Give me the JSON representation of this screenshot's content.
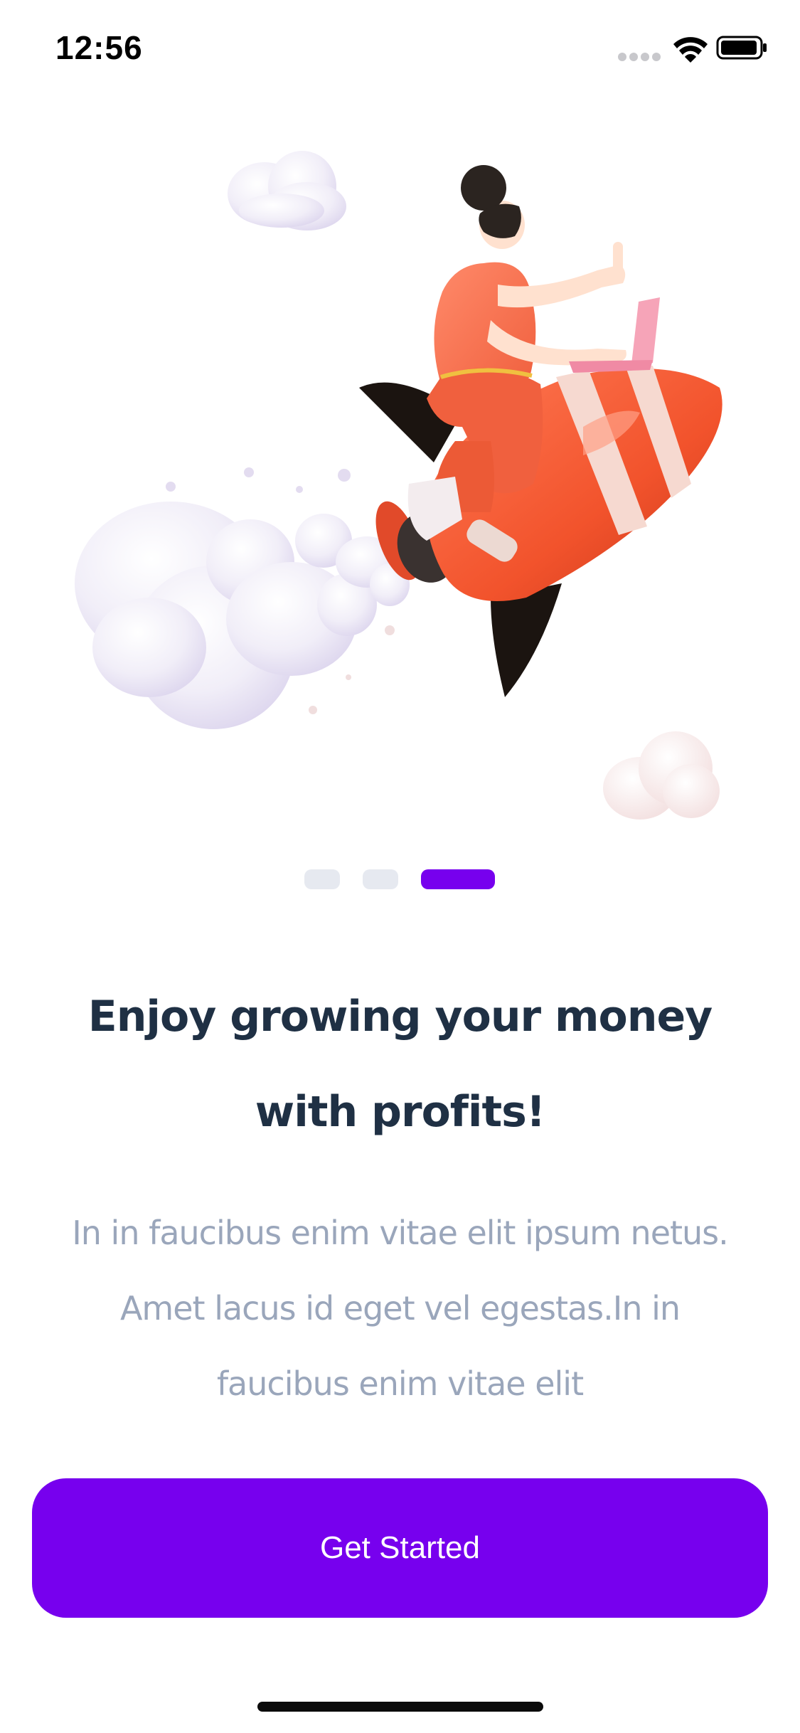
{
  "status_bar": {
    "time": "12:56",
    "icons": [
      "signal-dots-icon",
      "wifi-icon",
      "battery-icon"
    ]
  },
  "illustration": {
    "subject": "rocket-rider-illustration"
  },
  "pager": {
    "total": 3,
    "active_index": 2,
    "active_color": "#7700ee",
    "inactive_color": "#e6e9f0"
  },
  "onboarding": {
    "title_line1": "Enjoy growing your money",
    "title_line2": "with profits!",
    "body_line1": "In in faucibus enim vitae elit ipsum netus.",
    "body_line2": "Amet lacus id eget vel egestas.In in",
    "body_line3": "faucibus enim vitae elit",
    "cta_label": "Get Started"
  },
  "colors": {
    "primary": "#7700ee",
    "title": "#1f3044",
    "body": "#9aa6bb"
  }
}
